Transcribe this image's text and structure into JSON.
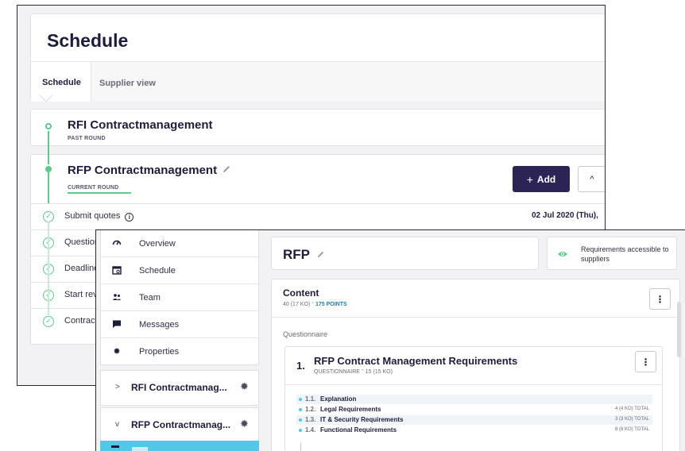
{
  "schedule": {
    "title": "Schedule",
    "tabs": [
      {
        "label": "Schedule",
        "active": true
      },
      {
        "label": "Supplier view",
        "active": false
      }
    ],
    "past_round": {
      "title": "RFI Contractmanagement",
      "status": "PAST ROUND"
    },
    "current_round": {
      "title": "RFP Contractmanagement",
      "status": "CURRENT ROUND",
      "add_label": "Add",
      "add_icon": "+",
      "collapse_icon": "^",
      "steps": [
        {
          "label": "Submit quotes",
          "date": "02 Jul 2020 (Thu),"
        },
        {
          "label": "Question",
          "date": ""
        },
        {
          "label": "Deadline",
          "date": ""
        },
        {
          "label": "Start revi",
          "date": ""
        },
        {
          "label": "Contract",
          "date": ""
        }
      ]
    }
  },
  "sidebar": {
    "nav": [
      {
        "label": "Overview",
        "icon": "gauge-icon"
      },
      {
        "label": "Schedule",
        "icon": "calendar-icon"
      },
      {
        "label": "Team",
        "icon": "team-icon"
      },
      {
        "label": "Messages",
        "icon": "message-icon"
      },
      {
        "label": "Properties",
        "icon": "gear-icon"
      }
    ],
    "rounds": [
      {
        "label": "RFI Contractmanag...",
        "chevron": ">"
      },
      {
        "label": "RFP Contractmanag...",
        "chevron": "v"
      }
    ]
  },
  "rfp": {
    "title": "RFP",
    "access_text": "Requirements accessible to suppliers",
    "content": {
      "title": "Content",
      "meta": "40 (17 KO)",
      "points": "175 POINTS",
      "section_label": "Questionnaire",
      "questionnaire": {
        "number": "1.",
        "title": "RFP Contract Management Requirements",
        "meta": "QUESTIONNAIRE",
        "meta_count": "15 (15 KO)",
        "items": [
          {
            "num": "1.1.",
            "name": "Explanation",
            "total": ""
          },
          {
            "num": "1.2.",
            "name": "Legal Requirements",
            "total": "4 (4 KO) TOTAL"
          },
          {
            "num": "1.3.",
            "name": "IT & Security Requirements",
            "total": "3 (3 KO) TOTAL"
          },
          {
            "num": "1.4.",
            "name": "Functional Requirements",
            "total": "8 (8 KO) TOTAL"
          }
        ]
      }
    }
  },
  "colors": {
    "accent_green": "#5fc88f",
    "primary_dark": "#2d2456",
    "selected_blue": "#54c6e6"
  }
}
